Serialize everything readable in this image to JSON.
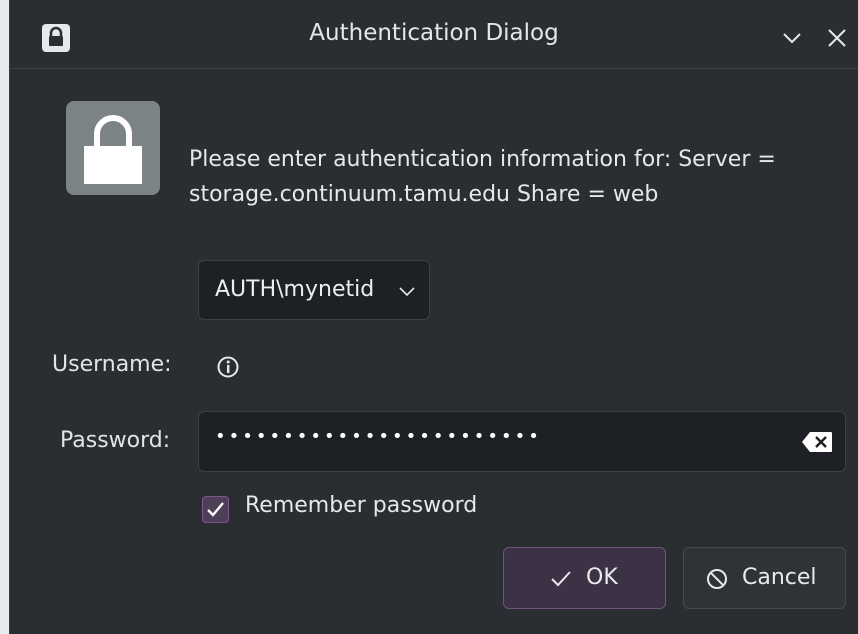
{
  "window": {
    "title": "Authentication Dialog"
  },
  "icons": {
    "title_icon": "lock-icon",
    "dialog_icon": "lock-icon",
    "minimize": "chevron-down-icon",
    "close": "close-icon",
    "username_info": "info-icon",
    "password_clear": "clear-text-icon",
    "ok": "checkmark-icon",
    "cancel": "cancel-icon"
  },
  "dialog": {
    "message_line1": "Please enter authentication information for: Server =",
    "message_line2": "storage.continuum.tamu.edu Share = web"
  },
  "form": {
    "domain_value": "AUTH\\mynetid",
    "username_label": "Username:",
    "password_label": "Password:",
    "password_masked": "••••••••••••••••••••••••",
    "remember_label": "Remember password",
    "remember_checked": true
  },
  "buttons": {
    "ok_label": "OK",
    "cancel_label": "Cancel"
  },
  "colors": {
    "background": "#2a2e32",
    "field": "#1d2024",
    "accent": "#6b5577"
  }
}
